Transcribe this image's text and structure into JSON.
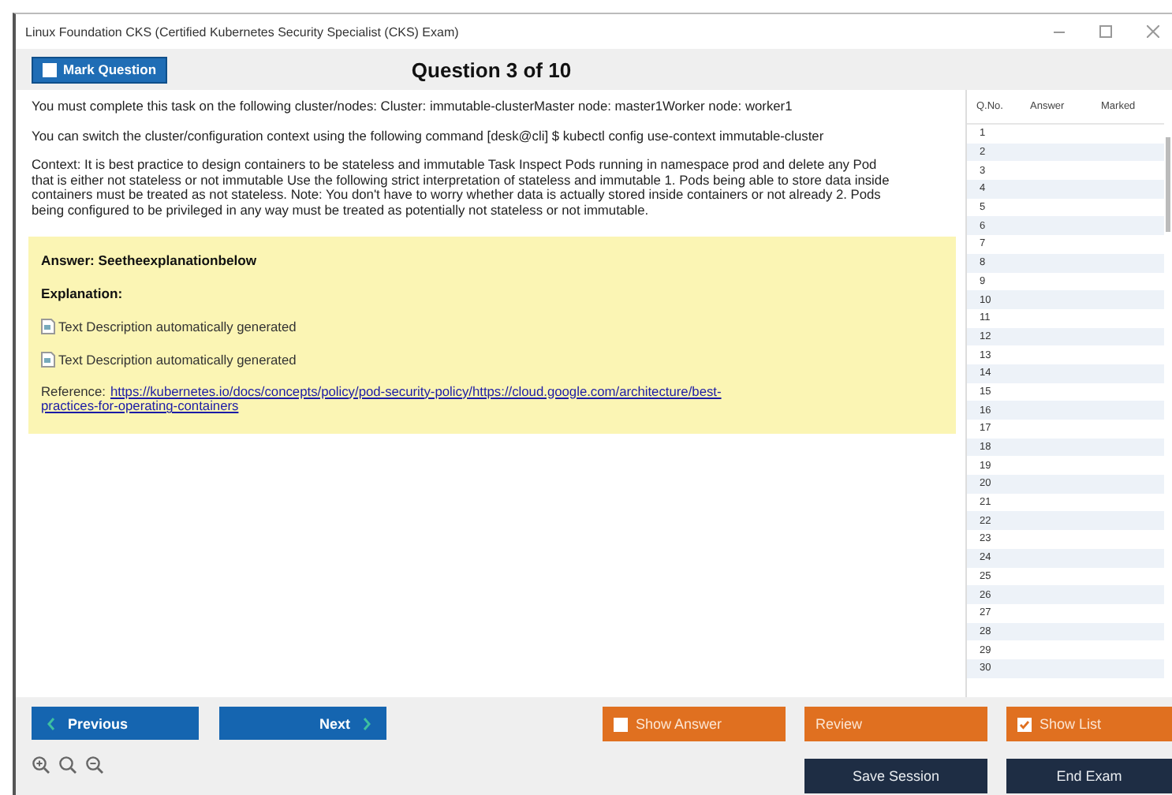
{
  "window": {
    "title": "Linux Foundation CKS (Certified Kubernetes Security Specialist (CKS) Exam)"
  },
  "header": {
    "mark_question": {
      "label": "Mark Question",
      "checked": false
    },
    "title": "Question 3 of 10"
  },
  "question": {
    "paragraphs": [
      "You must complete this task on the following cluster/nodes: Cluster: immutable-clusterMaster node: master1Worker node: worker1",
      "You can switch the cluster/configuration context using the following command [desk@cli] $ kubectl config use-context immutable-cluster",
      "Context: It is best practice to design containers to be stateless and immutable Task Inspect Pods running in namespace prod and delete any Pod that is either not stateless or not immutable Use the following strict interpretation of stateless and immutable 1. Pods being able to store data inside containers must be treated as not stateless. Note: You don't have to worry whether data is actually stored inside containers or not already 2. Pods being configured to be privileged in any way must be treated as potentially not stateless or not immutable."
    ]
  },
  "answer": {
    "answer_line": "Answer: Seetheexplanationbelow",
    "explanation_label": "Explanation:",
    "images": [
      {
        "alt": "Text Description automatically generated"
      },
      {
        "alt": "Text Description automatically generated"
      }
    ],
    "reference": {
      "label": "Reference:",
      "link_lines": [
        "https://kubernetes.io/docs/concepts/policy/pod-security-policy/https://cloud.google.com/architecture/best-",
        "practices-for-operating-containers"
      ]
    }
  },
  "question_list": {
    "columns": [
      "Q.No.",
      "Answer",
      "Marked"
    ],
    "rows": [
      {
        "number": "1"
      },
      {
        "number": "2"
      },
      {
        "number": "3"
      },
      {
        "number": "4"
      },
      {
        "number": "5"
      },
      {
        "number": "6"
      },
      {
        "number": "7"
      },
      {
        "number": "8"
      },
      {
        "number": "9"
      },
      {
        "number": "10"
      },
      {
        "number": "11"
      },
      {
        "number": "12"
      },
      {
        "number": "13"
      },
      {
        "number": "14"
      },
      {
        "number": "15"
      },
      {
        "number": "16"
      },
      {
        "number": "17"
      },
      {
        "number": "18"
      },
      {
        "number": "19"
      },
      {
        "number": "20"
      },
      {
        "number": "21"
      },
      {
        "number": "22"
      },
      {
        "number": "23"
      },
      {
        "number": "24"
      },
      {
        "number": "25"
      },
      {
        "number": "26"
      },
      {
        "number": "27"
      },
      {
        "number": "28"
      },
      {
        "number": "29"
      },
      {
        "number": "30"
      }
    ]
  },
  "bottom": {
    "previous": "Previous",
    "next": "Next",
    "show_answer": {
      "label": "Show Answer",
      "checked": false
    },
    "review": "Review",
    "show_list": {
      "label": "Show List",
      "checked": true
    },
    "save_session": "Save Session",
    "end_exam": "End Exam"
  }
}
